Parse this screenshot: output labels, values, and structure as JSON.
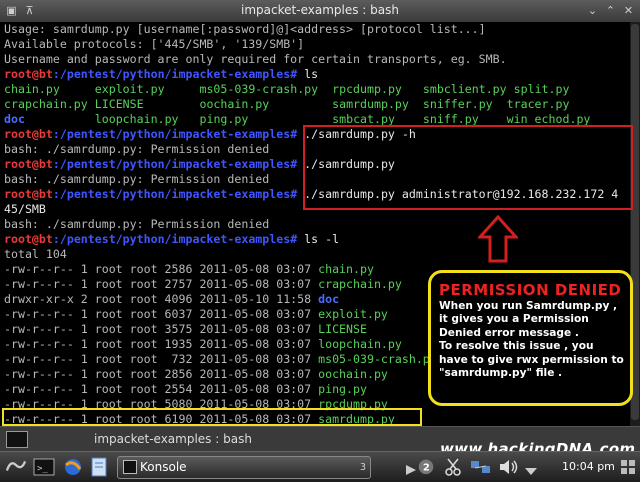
{
  "window": {
    "title": "impacket-examples : bash"
  },
  "terminal": {
    "prompt_user": "root@bt",
    "prompt_path": ":/pentest/python/impacket-examples#",
    "usage": [
      "Usage: samrdump.py [username[:password]@]<address> [protocol list...]",
      "Available protocols: ['445/SMB', '139/SMB']",
      "Username and password are only required for certain transports, eg. SMB."
    ],
    "cmd_ls": " ls",
    "ls_rows": [
      [
        "chain.py",
        "exploit.py",
        "ms05-039-crash.py",
        "rpcdump.py",
        "smbclient.py",
        "split.py"
      ],
      [
        "crapchain.py",
        "LICENSE",
        "oochain.py",
        "samrdump.py",
        "sniffer.py",
        "tracer.py"
      ],
      [
        "doc",
        "loopchain.py",
        "ping.py",
        "smbcat.py",
        "sniff.py",
        "win_echod.py"
      ]
    ],
    "cmd1": " ./samrdump.py -h",
    "denied": "bash: ./samrdump.py: Permission denied",
    "cmd2": " ./samrdump.py",
    "cmd3": " ./samrdump.py administrator@192.168.232.172 4",
    "cmd3_wrap": "45/SMB",
    "cmd_lsl": " ls -l",
    "total": "total 104",
    "listing": [
      {
        "perm": "-rw-r--r--",
        "links": "1",
        "owner": "root",
        "group": "root",
        "size": "2586",
        "date": "2011-05-08",
        "time": "03:07",
        "name": "chain.py",
        "dir": false
      },
      {
        "perm": "-rw-r--r--",
        "links": "1",
        "owner": "root",
        "group": "root",
        "size": "2757",
        "date": "2011-05-08",
        "time": "03:07",
        "name": "crapchain.py",
        "dir": false
      },
      {
        "perm": "drwxr-xr-x",
        "links": "2",
        "owner": "root",
        "group": "root",
        "size": "4096",
        "date": "2011-05-10",
        "time": "11:58",
        "name": "doc",
        "dir": true
      },
      {
        "perm": "-rw-r--r--",
        "links": "1",
        "owner": "root",
        "group": "root",
        "size": "6037",
        "date": "2011-05-08",
        "time": "03:07",
        "name": "exploit.py",
        "dir": false
      },
      {
        "perm": "-rw-r--r--",
        "links": "1",
        "owner": "root",
        "group": "root",
        "size": "3575",
        "date": "2011-05-08",
        "time": "03:07",
        "name": "LICENSE",
        "dir": false
      },
      {
        "perm": "-rw-r--r--",
        "links": "1",
        "owner": "root",
        "group": "root",
        "size": "1935",
        "date": "2011-05-08",
        "time": "03:07",
        "name": "loopchain.py",
        "dir": false
      },
      {
        "perm": "-rw-r--r--",
        "links": "1",
        "owner": "root",
        "group": "root",
        "size": " 732",
        "date": "2011-05-08",
        "time": "03:07",
        "name": "ms05-039-crash.py",
        "dir": false
      },
      {
        "perm": "-rw-r--r--",
        "links": "1",
        "owner": "root",
        "group": "root",
        "size": "2856",
        "date": "2011-05-08",
        "time": "03:07",
        "name": "oochain.py",
        "dir": false
      },
      {
        "perm": "-rw-r--r--",
        "links": "1",
        "owner": "root",
        "group": "root",
        "size": "2554",
        "date": "2011-05-08",
        "time": "03:07",
        "name": "ping.py",
        "dir": false
      },
      {
        "perm": "-rw-r--r--",
        "links": "1",
        "owner": "root",
        "group": "root",
        "size": "5080",
        "date": "2011-05-08",
        "time": "03:07",
        "name": "rpcdump.py",
        "dir": false
      },
      {
        "perm": "-rw-r--r--",
        "links": "1",
        "owner": "root",
        "group": "root",
        "size": "6190",
        "date": "2011-05-08",
        "time": "03:07",
        "name": "samrdump.py",
        "dir": false
      }
    ]
  },
  "annotation": {
    "title": "PERMISSION DENIED",
    "body": "When  you run Samrdump.py , it gives you a Permission Denied error message .\n To resolve this issue , you have to give rwx permission to \"samrdump.py\" file ."
  },
  "tab": {
    "label": "impacket-examples : bash"
  },
  "watermark": "www.hackingDNA.com",
  "taskbar": {
    "task_label": "Konsole",
    "task_count": "3",
    "badge": "2",
    "clock": "10:04 pm"
  },
  "colors": {
    "prompt_red": "#e83a3a",
    "path_blue": "#3f56ff",
    "file_green": "#57d15a",
    "highlight": "#d12020",
    "note_border": "#f2e11a"
  }
}
